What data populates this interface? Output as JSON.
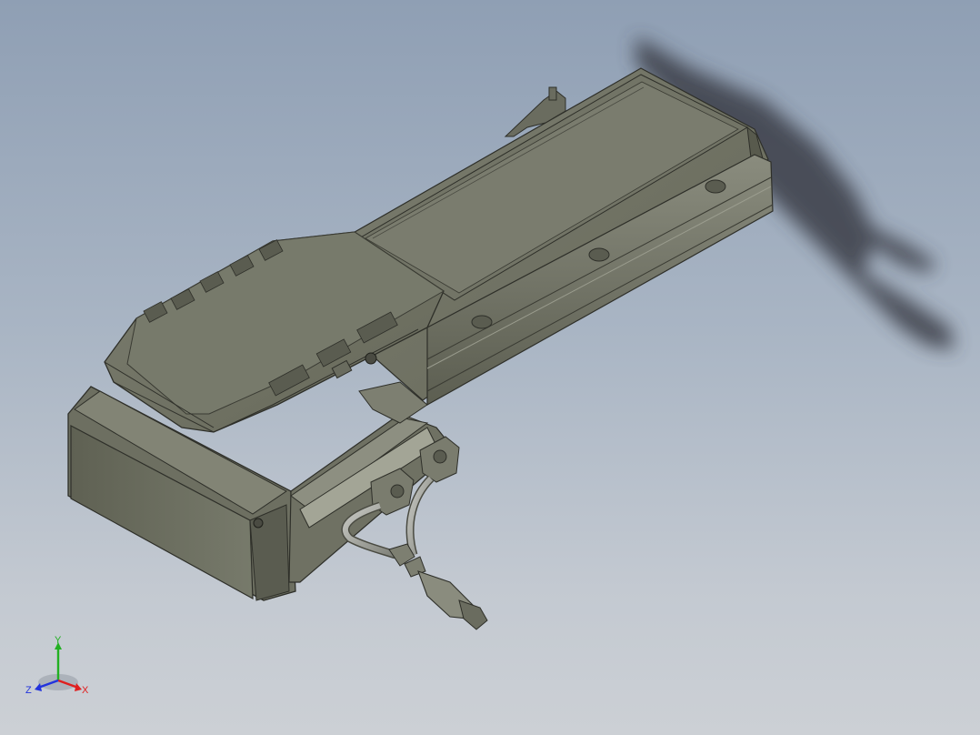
{
  "scene": {
    "background_top": "#8f9fb4",
    "background_bottom": "#ccd0d5",
    "model_color": "#6f7163",
    "edge_color": "#2e2f29"
  },
  "triad": {
    "x_label": "X",
    "y_label": "Y",
    "z_label": "Z",
    "x_color": "#e01f1f",
    "y_color": "#22b022",
    "z_color": "#2233dd"
  }
}
